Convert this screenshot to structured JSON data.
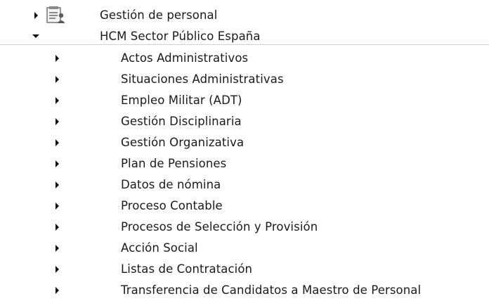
{
  "tree": {
    "top_items": [
      {
        "label": "Gestión de personal",
        "state": "collapsed",
        "icon": "personnel-folder-icon"
      },
      {
        "label": "HCM Sector Público España",
        "state": "expanded"
      }
    ],
    "children": [
      {
        "label": "Actos Administrativos"
      },
      {
        "label": "Situaciones Administrativas"
      },
      {
        "label": "Empleo Militar (ADT)"
      },
      {
        "label": "Gestión Disciplinaria"
      },
      {
        "label": "Gestión Organizativa"
      },
      {
        "label": "Plan de Pensiones"
      },
      {
        "label": "Datos de nómina"
      },
      {
        "label": "Proceso Contable"
      },
      {
        "label": "Procesos de Selección y Provisión"
      },
      {
        "label": "Acción Social"
      },
      {
        "label": "Listas de Contratación"
      },
      {
        "label": "Transferencia de Candidatos a Maestro de Personal"
      }
    ]
  },
  "colors": {
    "text": "#1a1a1a",
    "arrow": "#111111",
    "divider": "#cfd3d8",
    "background": "#ffffff"
  }
}
